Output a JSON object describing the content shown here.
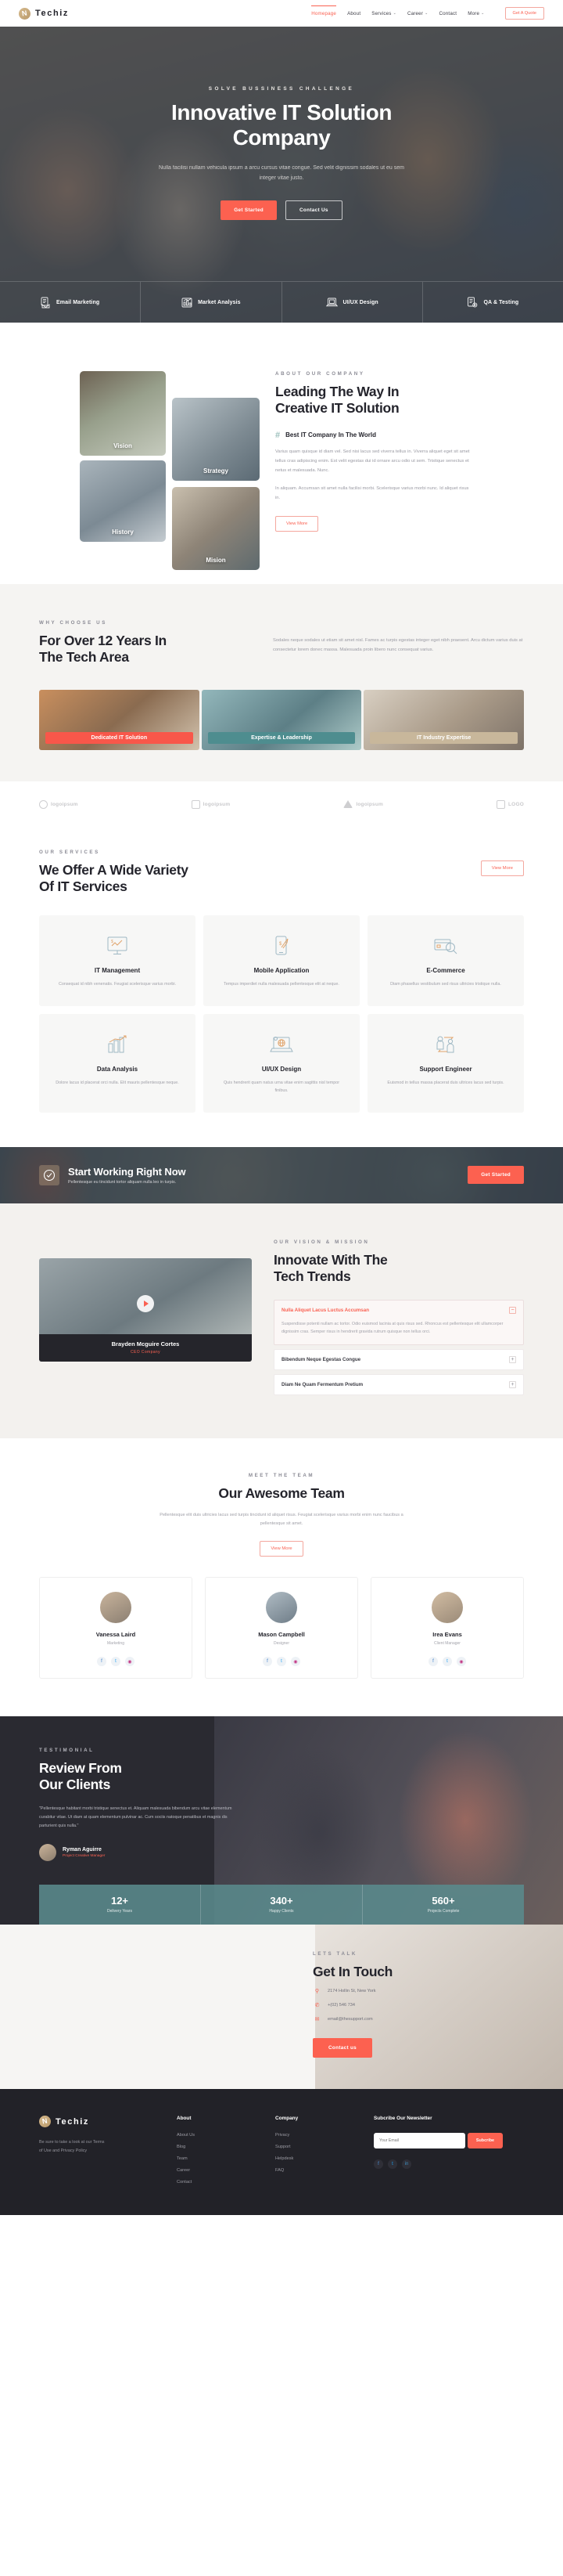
{
  "brand": {
    "name": "Techiz",
    "logo_glyph": "N"
  },
  "header": {
    "nav": [
      {
        "label": "Homepage",
        "active": true,
        "caret": ""
      },
      {
        "label": "About",
        "active": false,
        "caret": ""
      },
      {
        "label": "Services",
        "active": false,
        "caret": "⌄"
      },
      {
        "label": "Career",
        "active": false,
        "caret": "⌄"
      },
      {
        "label": "Contact",
        "active": false,
        "caret": ""
      },
      {
        "label": "More",
        "active": false,
        "caret": "⌄"
      }
    ],
    "quote_button": "Get A Quote"
  },
  "hero": {
    "eyebrow": "SOLVE BUSSINESS CHALLENGE",
    "title_line1": "Innovative IT Solution",
    "title_line2": "Company",
    "subtitle": "Nulla facilisi nullam vehicula ipsum a arcu cursus vitae congue. Sed velit dignissim sodales ut eu sem integer vitae justo.",
    "primary_button": "Get Started",
    "secondary_button": "Contact Us",
    "features": [
      {
        "label": "Email Marketing",
        "icon": "envelope-document-icon"
      },
      {
        "label": "Market Analysis",
        "icon": "bar-chart-icon"
      },
      {
        "label": "UI/UX Design",
        "icon": "laptop-icon"
      },
      {
        "label": "QA & Testing",
        "icon": "checklist-gear-icon"
      }
    ]
  },
  "about": {
    "eyebrow": "ABOUT OUR COMPANY",
    "title_line1": "Leading The Way In",
    "title_line2": "Creative IT Solution",
    "feature_title": "Best IT Company In The World",
    "paragraph1": "Varius quam quisque id diam vel. Sed nisi lacus sed viverra tellus in. Viverra aliquet eget sit amet tellus cras adipiscing enim. Est velit egestas dui id ornare arcu odio ut sem. Tristique senectus et netus et malesuada. Nunc.",
    "paragraph2": "In aliquam. Accumsan sit amet nulla facilisi morbi. Scelerisque varius morbi nunc. Id aliquet risus in.",
    "button": "View More",
    "photos": [
      {
        "caption": "Vision"
      },
      {
        "caption": "Strategy"
      },
      {
        "caption": "History"
      },
      {
        "caption": "Mision"
      }
    ]
  },
  "why": {
    "eyebrow": "WHY CHOOSE US",
    "title_line1": "For Over 12 Years In",
    "title_line2": "The Tech Area",
    "paragraph": "Sodales neque sodales ut etiam sit amet nisl. Fames ac turpis egestas integer eget nibh praesent. Arcu dictum varius duis at consectetur lorem donec massa. Malesuada proin libero nunc consequat varius.",
    "bands": [
      {
        "label": "Dedicated IT Solution",
        "tag_color": "#f8574a"
      },
      {
        "label": "Expertise & Leadership",
        "tag_color": "#4e8d8f"
      },
      {
        "label": "IT Industry Expertise",
        "tag_color": "#c8b79b"
      }
    ]
  },
  "brands": [
    {
      "name": "logoipsum",
      "icon": "hexagon-icon"
    },
    {
      "name": "logoipsum",
      "icon": "asterisk-icon"
    },
    {
      "name": "logoipsum",
      "icon": "triangle-icon"
    },
    {
      "name": "LOGO",
      "icon": "squares-icon"
    }
  ],
  "services": {
    "eyebrow": "OUR SERVICES",
    "title_line1": "We Offer A Wide Variety",
    "title_line2": "Of IT Services",
    "button": "View More",
    "cards": [
      {
        "title": "IT Management",
        "desc": "Consequat id nibh venenatis. Feugiat scelerisque varius morbi.",
        "icon": "monitor-chart-icon"
      },
      {
        "title": "Mobile Application",
        "desc": "Tempus imperdiet nulla malesuada pellentesque elit at neque.",
        "icon": "mobile-rocket-icon"
      },
      {
        "title": "E-Commerce",
        "desc": "Diam phasellus vestibulum sed risus ultricies tristique nulla.",
        "icon": "card-search-icon"
      },
      {
        "title": "Data Analysis",
        "desc": "Dolore lacus id placerat orci nulla. Elit mauris pellentesque neque.",
        "icon": "bar-growth-icon"
      },
      {
        "title": "UI/UX Design",
        "desc": "Quis hendrerit quam natus urna vitae enim sagittis nisl tempor finibus.",
        "icon": "laptop-globe-icon"
      },
      {
        "title": "Support Engineer",
        "desc": "Euismod in tellus massa placerat duis ultrices lacus sed turpis.",
        "icon": "people-support-icon"
      }
    ]
  },
  "cta": {
    "title": "Start Working Right Now",
    "subtitle": "Pellentesque eu tincidunt tortor aliquam nulla leo in turpis.",
    "button": "Get Started",
    "icon": "check-circle-icon"
  },
  "vision": {
    "eyebrow": "OUR VISION & MISSION",
    "title_line1": "Innovate With The",
    "title_line2": "Tech Trends",
    "video_name": "Brayden Mcguire Cortes",
    "video_role": "CEO Company",
    "accordion": [
      {
        "title": "Nulla Aliquet Lacus Luctus Accumsan",
        "sign": "−",
        "open": true,
        "body": "Suspendisse potenti nullam ac tortor. Odio euismod lacinia at quis risus sed. Rhoncus est pellentesque elit ullamcorper dignissim cras. Semper risus in hendrerit gravida rutrum quisque non tellus orci."
      },
      {
        "title": "Bibendum Neque Egestas Congue",
        "sign": "+",
        "open": false,
        "body": ""
      },
      {
        "title": "Diam Ne Quam Fermentum Pretium",
        "sign": "+",
        "open": false,
        "body": ""
      }
    ]
  },
  "team": {
    "eyebrow": "MEET THE TEAM",
    "title": "Our Awesome Team",
    "subtitle": "Pellentesque elit duis ultricies lacus sed turpis tincidunt id aliquet risus. Feugiat scelerisque varius morbi enim nunc faucibus a pellentesque sit amet.",
    "button": "View More",
    "members": [
      {
        "name": "Vanessa Laird",
        "role": "Marketing",
        "socials": [
          "f",
          "t",
          "ig"
        ]
      },
      {
        "name": "Mason Campbell",
        "role": "Designer",
        "socials": [
          "f",
          "t",
          "ig"
        ]
      },
      {
        "name": "Irea Evans",
        "role": "Client Manager",
        "socials": [
          "f",
          "t",
          "ig"
        ]
      }
    ]
  },
  "testimonial": {
    "eyebrow": "TESTIMONIAL",
    "title_line1": "Review From",
    "title_line2": "Our Clients",
    "quote": "\"Pellentesque habitant morbi tristique senectus et. Aliquam malesuada bibendum arcu vitae elementum curabitur vitae. Ut diam at quam elementum pulvinar ac. Cum sociis natoque penatibus et magnis dis parturient quis nulla.\"",
    "person_name": "Ryman Aguirre",
    "person_role": "Project Creative Manager",
    "stats": [
      {
        "value": "12+",
        "label": "Delivery Years"
      },
      {
        "value": "340+",
        "label": "Happy Clients"
      },
      {
        "value": "560+",
        "label": "Projects Complete"
      }
    ]
  },
  "contact": {
    "eyebrow": "LETS TALK",
    "title": "Get In Touch",
    "rows": [
      {
        "icon": "location-icon",
        "text": "2174 Hollin St, New York"
      },
      {
        "icon": "phone-icon",
        "text": "+(02) 546 734"
      },
      {
        "icon": "mail-icon",
        "text": "email@thesupport.com"
      }
    ],
    "button": "Contact us"
  },
  "footer": {
    "note": "Be sure to take a look at our Terms of Use and Privacy Policy",
    "columns": [
      {
        "head": "About",
        "links": [
          "About Us",
          "Blog",
          "Team",
          "Career",
          "Contact"
        ]
      },
      {
        "head": "Company",
        "links": [
          "Privacy",
          "Support",
          "Helpdesk",
          "FAQ"
        ]
      }
    ],
    "newsletter_head": "Subcribe Our Newsletter",
    "newsletter_placeholder": "Your Email",
    "newsletter_button": "Subcribe",
    "socials": [
      "f",
      "t",
      "in"
    ]
  }
}
